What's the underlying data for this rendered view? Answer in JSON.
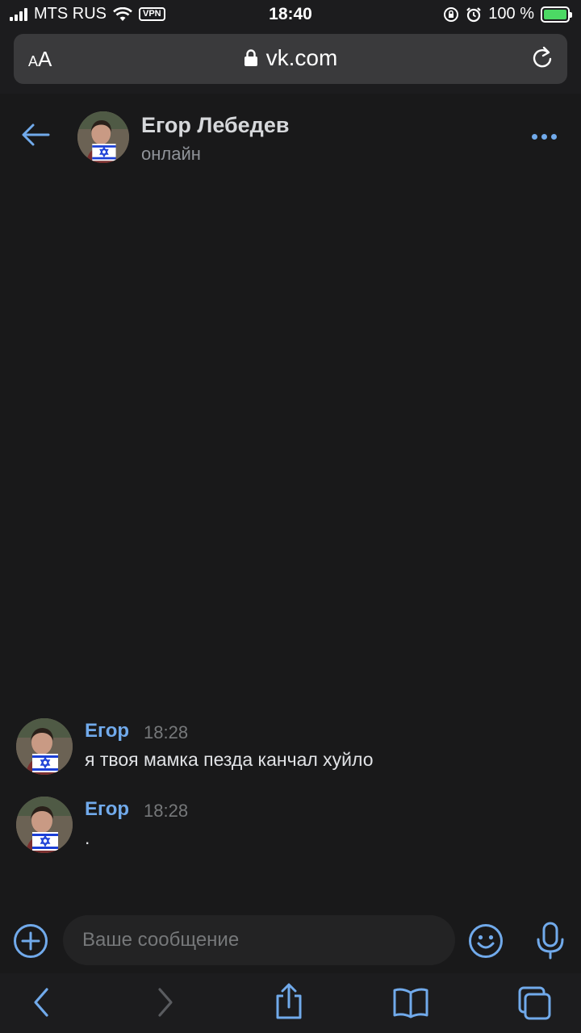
{
  "status_bar": {
    "carrier": "MTS RUS",
    "vpn": "VPN",
    "time": "18:40",
    "battery": "100 %"
  },
  "browser": {
    "text_size_small": "A",
    "text_size_large": "A",
    "url": "vk.com"
  },
  "chat": {
    "name": "Егор Лебедев",
    "status": "онлайн",
    "messages": [
      {
        "author": "Егор",
        "time": "18:28",
        "text": "я твоя мамка пезда канчал хуйло"
      },
      {
        "author": "Егор",
        "time": "18:28",
        "text": "."
      }
    ]
  },
  "composer": {
    "placeholder": "Ваше сообщение"
  },
  "colors": {
    "accent": "#71aaeb",
    "background": "#19191a",
    "input": "#232324"
  },
  "icons": [
    "signal-icon",
    "wifi-icon",
    "lock-rotation-icon",
    "alarm-icon",
    "battery-icon",
    "padlock-icon",
    "reload-icon",
    "back-arrow-icon",
    "more-icon",
    "plus-icon",
    "emoji-icon",
    "microphone-icon",
    "browser-back-icon",
    "browser-forward-icon",
    "share-icon",
    "bookmarks-icon",
    "tabs-icon"
  ]
}
